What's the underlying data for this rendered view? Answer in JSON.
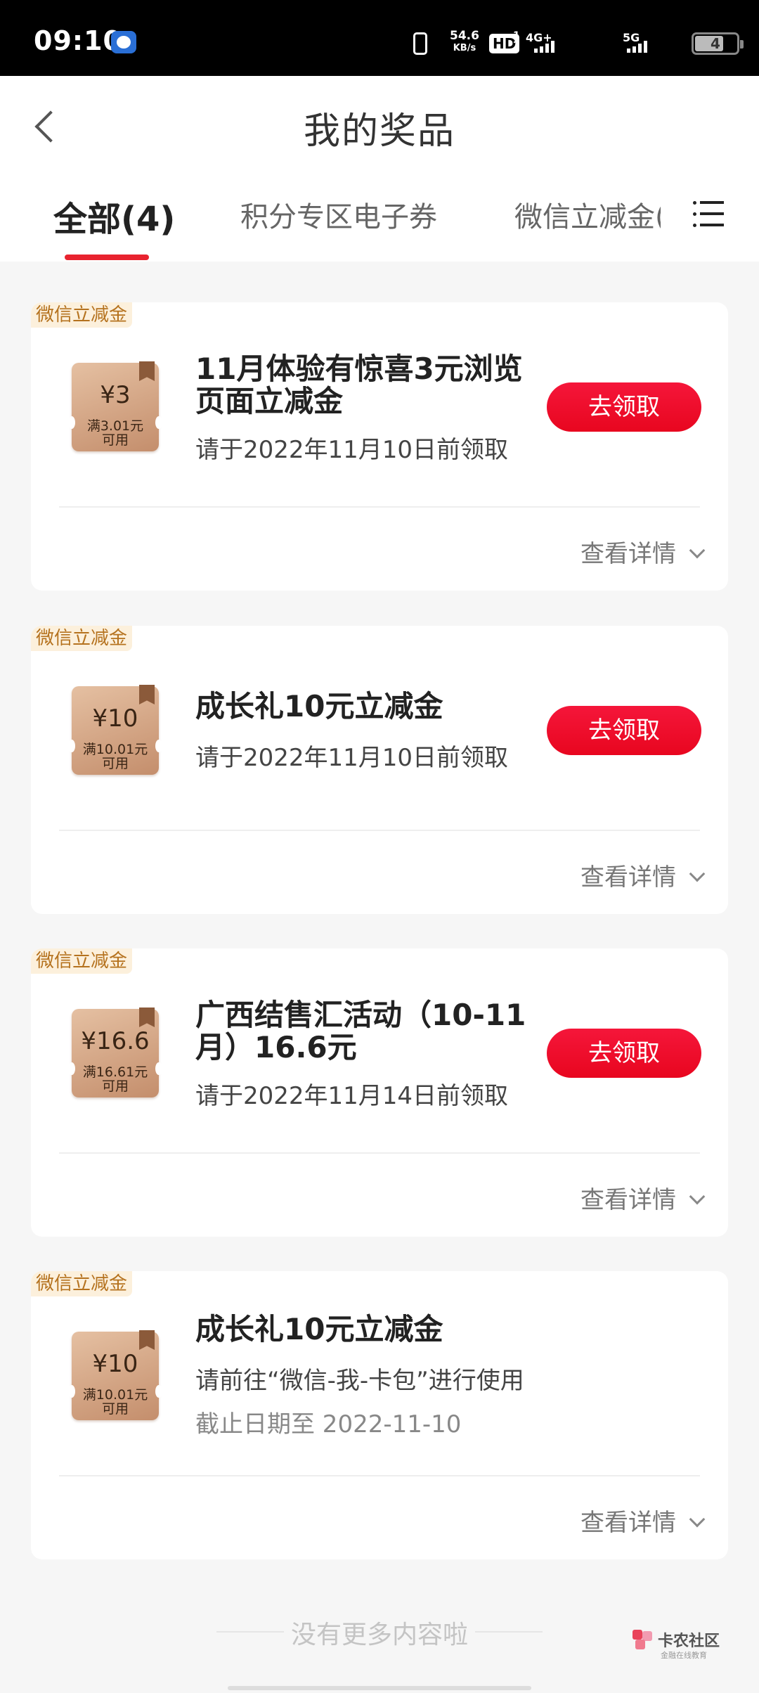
{
  "status_bar": {
    "time": "09:10",
    "net_speed_value": "54.6",
    "net_speed_unit": "KB/s",
    "hd_label": "HD",
    "hd_sub_top": "1",
    "hd_sub_bottom": "2",
    "sig1_label": "4G+",
    "sig2_label": "5G",
    "battery": "4",
    "icons": [
      "app-icon",
      "vibrate-icon",
      "hd-icon",
      "signal-icon",
      "battery-icon"
    ]
  },
  "header": {
    "title": "我的奖品"
  },
  "tabs": [
    {
      "label": "全部(4)",
      "active": true
    },
    {
      "label": "积分专区电子券",
      "active": false
    },
    {
      "label": "微信立减金(",
      "active": false
    }
  ],
  "accent_color": "#e8232f",
  "cards": [
    {
      "tag": "微信立减金",
      "coupon_amount": "¥3",
      "coupon_condition_1": "满3.01元",
      "coupon_condition_2": "可用",
      "title": "11月体验有惊喜3元浏览页面立减金",
      "subtitle": "请于2022年11月10日前领取",
      "button": "去领取",
      "details": "查看详情"
    },
    {
      "tag": "微信立减金",
      "coupon_amount": "¥10",
      "coupon_condition_1": "满10.01元",
      "coupon_condition_2": "可用",
      "title": "成长礼10元立减金",
      "subtitle": "请于2022年11月10日前领取",
      "button": "去领取",
      "details": "查看详情"
    },
    {
      "tag": "微信立减金",
      "coupon_amount": "¥16.6",
      "coupon_condition_1": "满16.61元",
      "coupon_condition_2": "可用",
      "title": "广西结售汇活动（10-11月）16.6元",
      "subtitle": "请于2022年11月14日前领取",
      "button": "去领取",
      "details": "查看详情"
    },
    {
      "tag": "微信立减金",
      "coupon_amount": "¥10",
      "coupon_condition_1": "满10.01元",
      "coupon_condition_2": "可用",
      "title": "成长礼10元立减金",
      "subtitle": "请前往“微信-我-卡包”进行使用",
      "subtitle2": "截止日期至 2022-11-10",
      "details": "查看详情"
    }
  ],
  "footer": {
    "no_more": "没有更多内容啦"
  },
  "watermark": {
    "title": "卡农社区",
    "subtitle": "金融在线教育"
  }
}
